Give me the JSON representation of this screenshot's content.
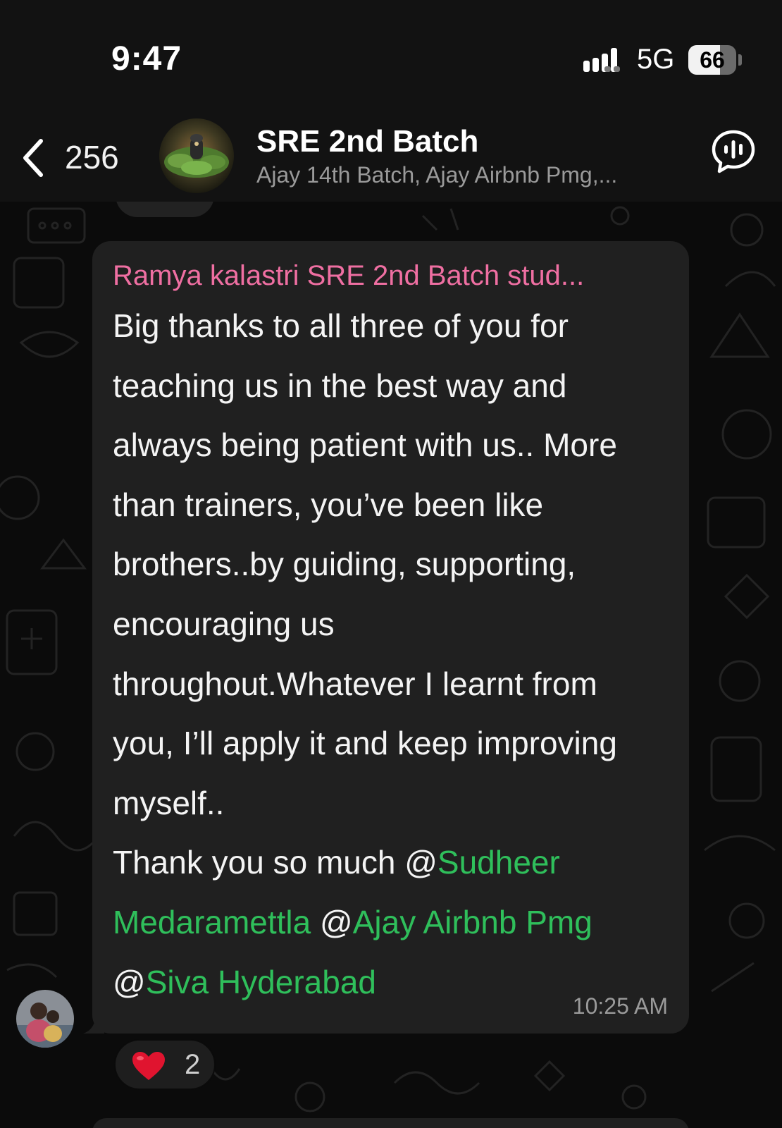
{
  "status_bar": {
    "time": "9:47",
    "network": "5G",
    "battery_level": "66",
    "battery_fraction": 0.66
  },
  "header": {
    "back_count": "256",
    "group_name": "SRE 2nd Batch",
    "members_preview": "Ajay 14th Batch, Ajay Airbnb Pmg,..."
  },
  "message": {
    "sender": "Ramya kalastri SRE 2nd Batch stud...",
    "text": "Big thanks to all three of you for\nteaching us in the best way and\nalways being patient with us.. More\nthan trainers, you’ve been like\nbrothers..by guiding, supporting,\nencouraging us\nthroughout.Whatever I learnt from\nyou, I’ll apply it and keep improving\nmyself..\nThank you so much ",
    "mention_at_1": "@",
    "mention_1": "Sudheer\nMedaramettla",
    "mention_at_2": " @",
    "mention_2": "Ajay Airbnb Pmg",
    "mention_at_3": "\n@",
    "mention_3": "Siva Hyderabad",
    "time": "10:25 AM"
  },
  "reaction": {
    "emoji": "heart",
    "count": "2"
  },
  "colors": {
    "sender_name": "#ef6fa2",
    "mention": "#2fbf5b",
    "bubble": "#202020",
    "background": "#0b0b0b"
  }
}
